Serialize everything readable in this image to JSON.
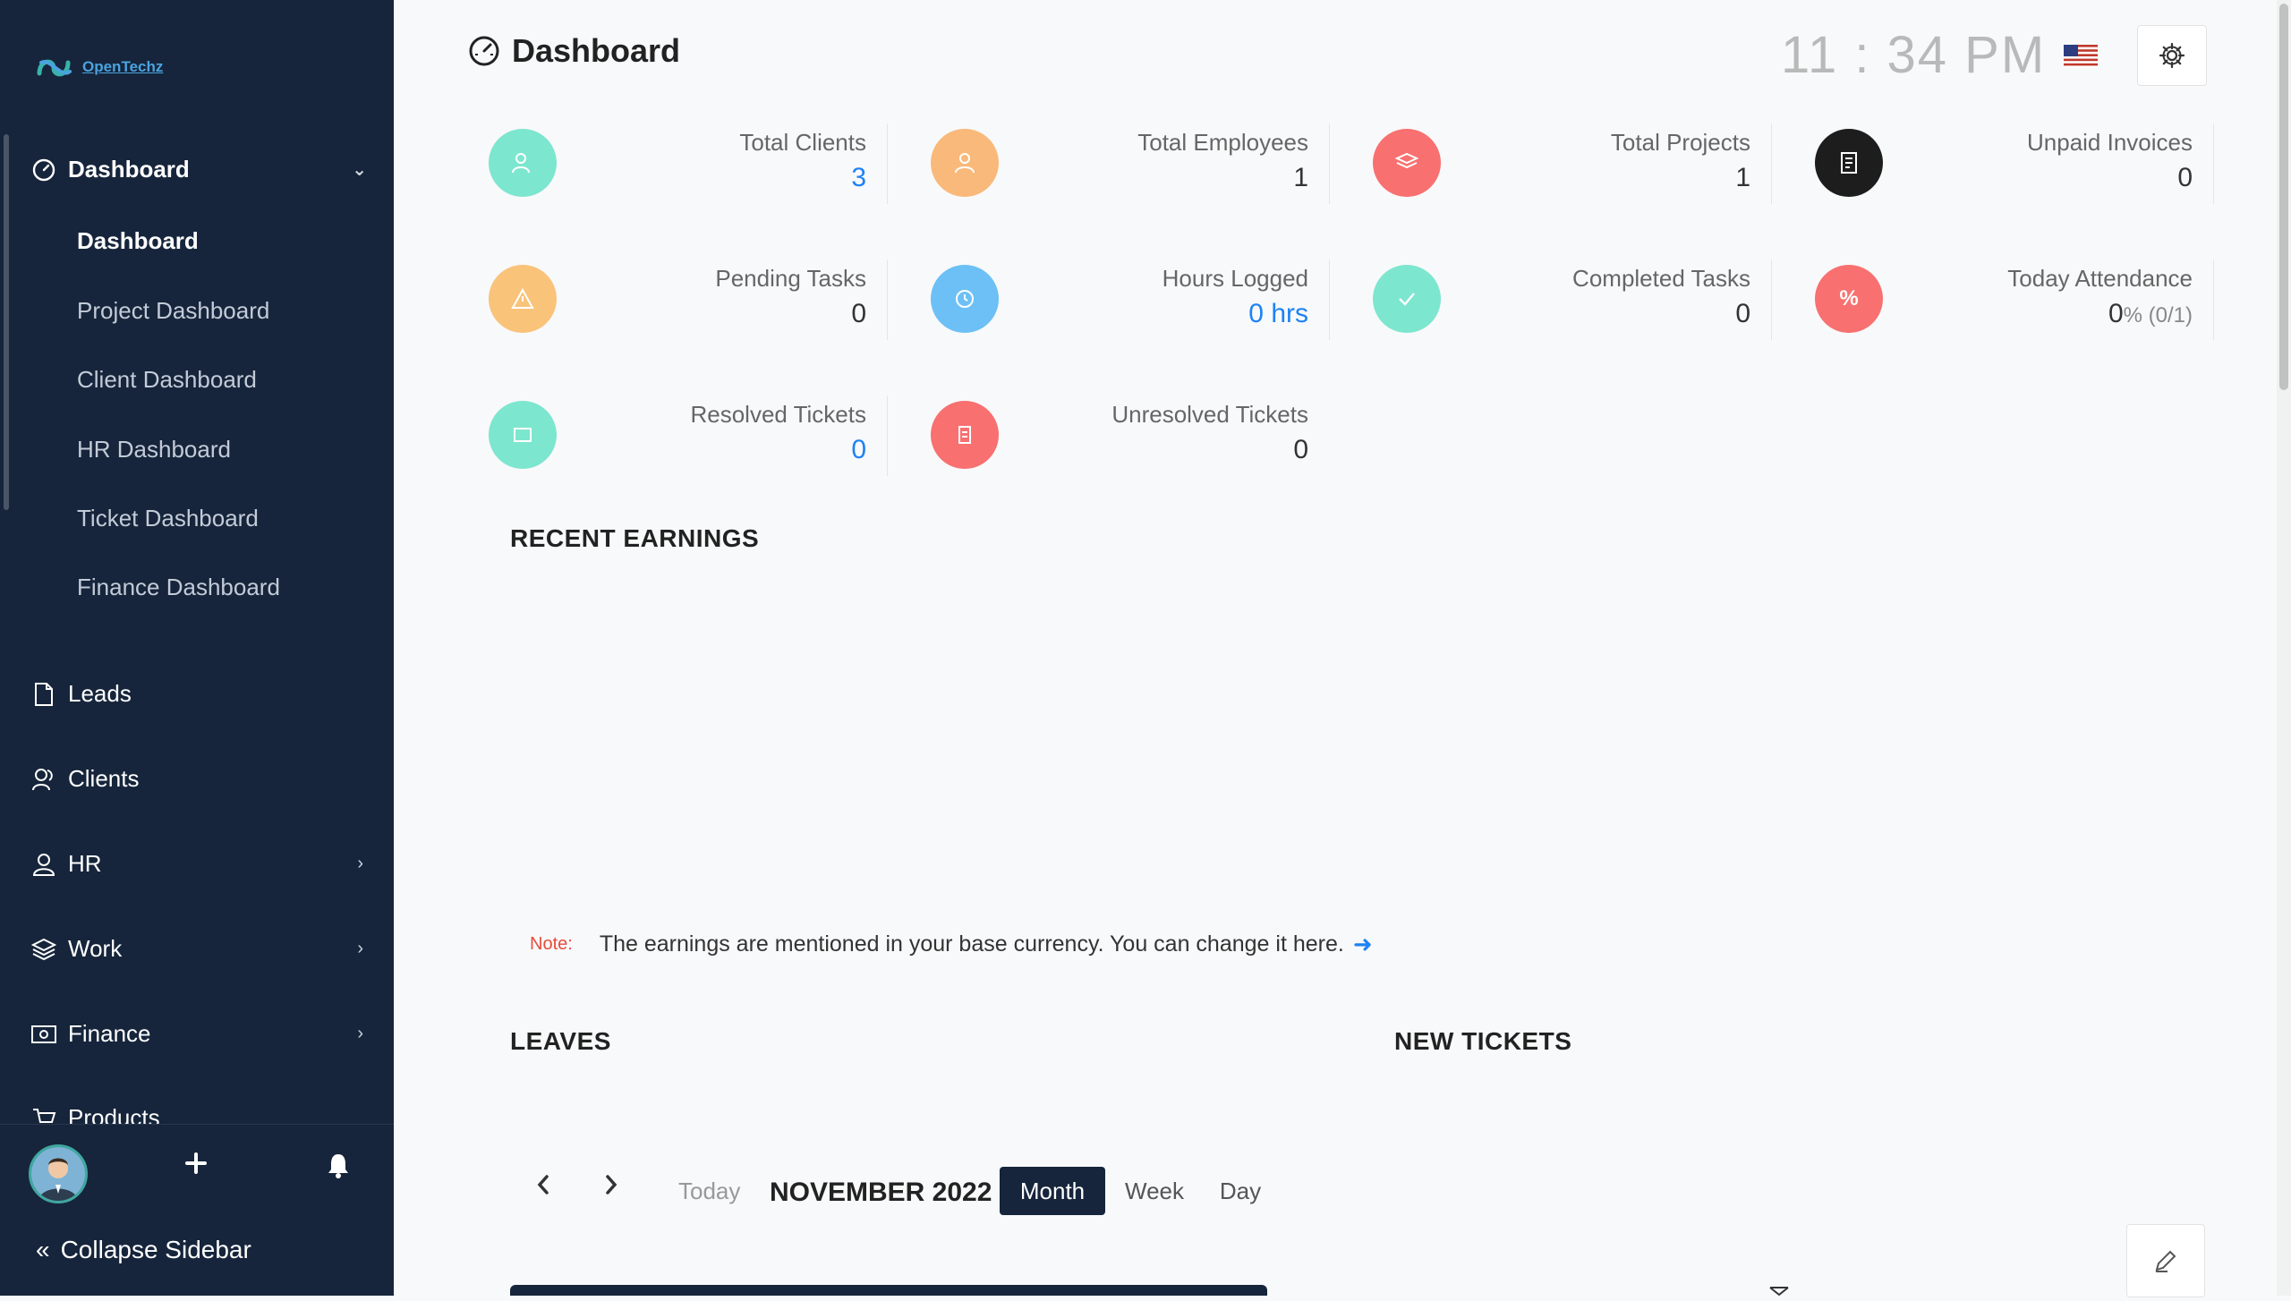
{
  "brand": {
    "name": "OpenTechz"
  },
  "header": {
    "title": "Dashboard",
    "time": "11 : 34 PM",
    "language_flag": "us-flag-icon"
  },
  "sidebar": {
    "dashboard": {
      "label": "Dashboard",
      "icon": "speedometer-icon"
    },
    "sub_items": [
      {
        "label": "Dashboard",
        "active": true
      },
      {
        "label": "Project Dashboard"
      },
      {
        "label": "Client Dashboard"
      },
      {
        "label": "HR Dashboard"
      },
      {
        "label": "Ticket Dashboard"
      },
      {
        "label": "Finance Dashboard"
      }
    ],
    "items": [
      {
        "label": "Leads",
        "icon": "file-icon"
      },
      {
        "label": "Clients",
        "icon": "clients-icon"
      },
      {
        "label": "HR",
        "icon": "user-icon"
      },
      {
        "label": "Work",
        "icon": "layers-icon"
      },
      {
        "label": "Finance",
        "icon": "money-icon"
      },
      {
        "label": "Products",
        "icon": "cart-icon"
      }
    ],
    "collapse_label": "Collapse Sidebar"
  },
  "stats": [
    {
      "label": "Total Clients",
      "value": "3",
      "color": "#7de6cf",
      "icon": "user-plus-icon"
    },
    {
      "label": "Total Employees",
      "value": "1",
      "color": "#f9b97a",
      "icon": "employee-icon"
    },
    {
      "label": "Total Projects",
      "value": "1",
      "color": "#f87070",
      "icon": "layers-icon"
    },
    {
      "label": "Unpaid Invoices",
      "value": "0",
      "color": "#1d1d1d",
      "icon": "invoice-icon"
    },
    {
      "label": "Pending Tasks",
      "value": "0",
      "color": "#f9c37a",
      "icon": "warning-icon"
    },
    {
      "label": "Hours Logged",
      "value": "0 hrs",
      "color": "#6cc0f5",
      "icon": "clock-icon"
    },
    {
      "label": "Completed Tasks",
      "value": "0",
      "color": "#7de6cf",
      "icon": "check-icon"
    },
    {
      "label": "Today Attendance",
      "value": "0",
      "value_suffix": "% (0/1)",
      "color": "#f87070",
      "icon": "percent-icon"
    },
    {
      "label": "Resolved Tickets",
      "value": "0",
      "color": "#7de6cf",
      "icon": "ticket-check-icon"
    },
    {
      "label": "Unresolved Tickets",
      "value": "0",
      "color": "#f87070",
      "icon": "ticket-icon"
    }
  ],
  "sections": {
    "recent_earnings": "RECENT EARNINGS",
    "leaves": "LEAVES",
    "new_tickets": "NEW TICKETS"
  },
  "note": {
    "label": "Note:",
    "text": "The earnings are mentioned in your base currency. You can change it here."
  },
  "calendar": {
    "today": "Today",
    "title": "NOVEMBER 2022",
    "views": [
      "Month",
      "Week",
      "Day"
    ],
    "active_view": "Month"
  }
}
